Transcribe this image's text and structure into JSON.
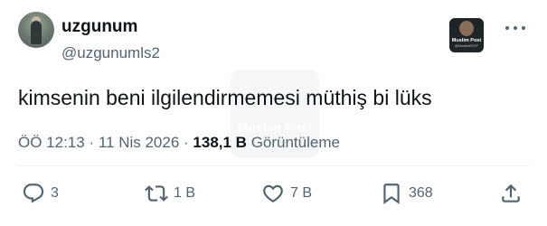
{
  "author": {
    "display_name": "uzgunum",
    "handle": "@uzgunumls2"
  },
  "badge": {
    "title": "Muslim Post",
    "subtitle": "@MuslimPOST"
  },
  "watermark": {
    "text": "Muslim Post"
  },
  "tweet": {
    "text": "kimsenin beni ilgilendirmemesi müthiş bi lüks"
  },
  "meta": {
    "time": "ÖÖ 12:13",
    "separator": " · ",
    "date": "11 Nis 2026",
    "views_count": "138,1 B",
    "views_label": "Görüntüleme"
  },
  "actions": {
    "replies": "3",
    "reposts": "1 B",
    "likes": "7 B",
    "bookmarks": "368"
  },
  "icons": [
    "reply-icon",
    "repost-icon",
    "like-icon",
    "bookmark-icon",
    "share-icon",
    "more-icon"
  ]
}
